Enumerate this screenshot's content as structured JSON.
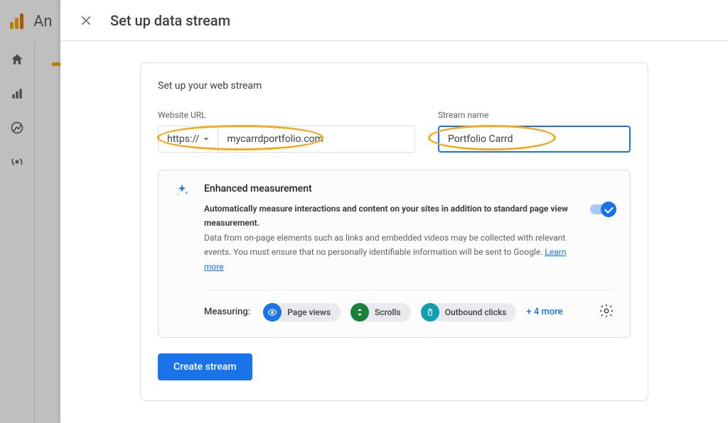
{
  "background": {
    "app_label": "An"
  },
  "modal": {
    "title": "Set up data stream",
    "card_subtitle": "Set up your web stream",
    "fields": {
      "url_label": "Website URL",
      "protocol": "https://",
      "url_value": "mycarrdportfolio.com",
      "name_label": "Stream name",
      "name_value": "Portfolio Carrd"
    },
    "enhanced": {
      "title": "Enhanced measurement",
      "desc_bold": "Automatically measure interactions and content on your sites in addition to standard page view measurement.",
      "desc_rest": "Data from on-page elements such as links and embedded videos may be collected with relevant events. You must ensure that no personally identifiable information will be sent to Google.",
      "learn_more": "Learn more",
      "toggle_on": true
    },
    "measuring": {
      "label": "Measuring:",
      "chips": [
        "Page views",
        "Scrolls",
        "Outbound clicks"
      ],
      "more": "+ 4 more"
    },
    "create_button": "Create stream"
  }
}
